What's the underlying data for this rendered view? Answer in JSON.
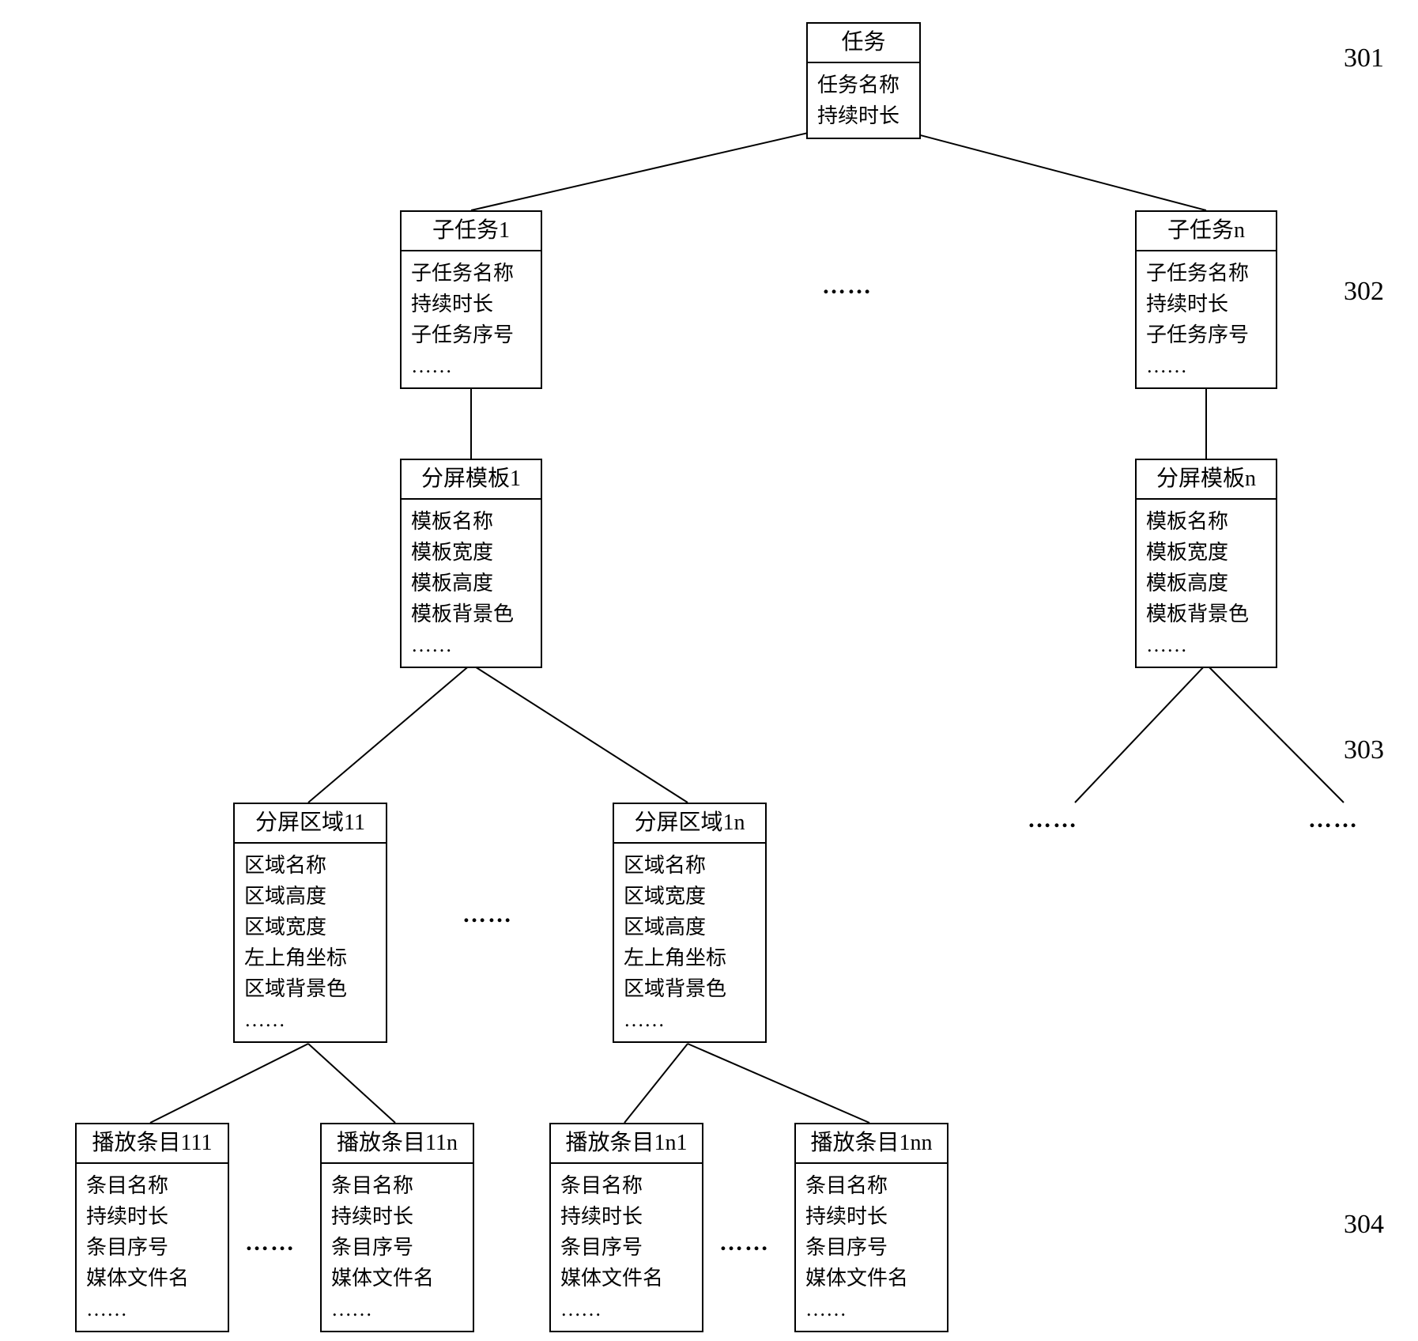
{
  "rowLabels": {
    "r1": "301",
    "r2": "302",
    "r3": "303",
    "r4": "304"
  },
  "ellipsis": "……",
  "task": {
    "title": "任务",
    "fields": [
      "任务名称",
      "持续时长"
    ]
  },
  "subtask1": {
    "title": "子任务1",
    "fields": [
      "子任务名称",
      "持续时长",
      "子任务序号",
      "……"
    ]
  },
  "subtaskN": {
    "title": "子任务n",
    "fields": [
      "子任务名称",
      "持续时长",
      "子任务序号",
      "……"
    ]
  },
  "template1": {
    "title": "分屏模板1",
    "fields": [
      "模板名称",
      "模板宽度",
      "模板高度",
      "模板背景色",
      "……"
    ]
  },
  "templateN": {
    "title": "分屏模板n",
    "fields": [
      "模板名称",
      "模板宽度",
      "模板高度",
      "模板背景色",
      "……"
    ]
  },
  "region11": {
    "title": "分屏区域11",
    "fields": [
      "区域名称",
      "区域高度",
      "区域宽度",
      "左上角坐标",
      "区域背景色",
      "……"
    ]
  },
  "region1n": {
    "title": "分屏区域1n",
    "fields": [
      "区域名称",
      "区域宽度",
      "区域高度",
      "左上角坐标",
      "区域背景色",
      "……"
    ]
  },
  "item111": {
    "title": "播放条目111",
    "fields": [
      "条目名称",
      "持续时长",
      "条目序号",
      "媒体文件名",
      "……"
    ]
  },
  "item11n": {
    "title": "播放条目11n",
    "fields": [
      "条目名称",
      "持续时长",
      "条目序号",
      "媒体文件名",
      "……"
    ]
  },
  "item1n1": {
    "title": "播放条目1n1",
    "fields": [
      "条目名称",
      "持续时长",
      "条目序号",
      "媒体文件名",
      "……"
    ]
  },
  "item1nn": {
    "title": "播放条目1nn",
    "fields": [
      "条目名称",
      "持续时长",
      "条目序号",
      "媒体文件名",
      "……"
    ]
  }
}
